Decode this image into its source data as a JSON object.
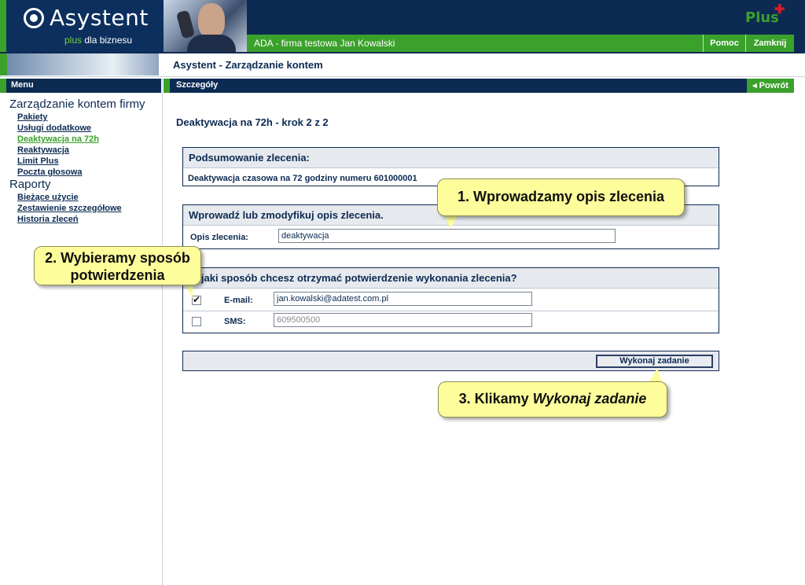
{
  "header": {
    "logo_title": "Asystent",
    "logo_sub_plus": "plus",
    "logo_sub_rest": " dla biznesu",
    "brand": "Plus",
    "company": "ADA - firma testowa Jan Kowalski",
    "help_label": "Pomoc",
    "close_label": "Zamknij"
  },
  "page_title": "Asystent - Zarządzanie kontem",
  "sidebar": {
    "menu_label": "Menu",
    "sections": [
      {
        "title": "Zarządzanie kontem firmy",
        "items": [
          "Pakiety",
          "Usługi dodatkowe",
          "Deaktywacja na 72h",
          "Reaktywacja",
          "Limit Plus",
          "Poczta głosowa"
        ]
      },
      {
        "title": "Raporty",
        "items": [
          "Bieżące użycie",
          "Zestawienie szczegółowe",
          "Historia zleceń"
        ]
      }
    ],
    "active_item": "Deaktywacja na 72h"
  },
  "content": {
    "header_label": "Szczegóły",
    "back_label": "◂ Powrót",
    "step_title": "Deaktywacja na 72h - krok 2 z 2",
    "summary": {
      "title": "Podsumowanie zlecenia:",
      "text": "Deaktywacja czasowa na 72 godziny numeru 601000001"
    },
    "description": {
      "title": "Wprowadź lub zmodyfikuj opis zlecenia.",
      "label": "Opis zlecenia:",
      "value": "deaktywacja"
    },
    "confirmation": {
      "title": "W jaki sposób chcesz otrzymać potwierdzenie wykonania zlecenia?",
      "email_label": "E-mail:",
      "email_value": "jan.kowalski@adatest.com.pl",
      "email_checked": true,
      "sms_label": "SMS:",
      "sms_value": "609500500",
      "sms_checked": false
    },
    "submit_label": "Wykonaj zadanie"
  },
  "callouts": {
    "step1": "1. Wprowadzamy opis zlecenia",
    "step2_line1": "2. Wybieramy sposób",
    "step2_line2": "potwierdzenia",
    "step3_prefix": "3. Klikamy ",
    "step3_italic": "Wykonaj zadanie"
  },
  "colors": {
    "navy": "#0c2a52",
    "green": "#3aa12b",
    "callout_yellow": "#fdfd9b",
    "panel_gray": "#e6e9ee"
  }
}
